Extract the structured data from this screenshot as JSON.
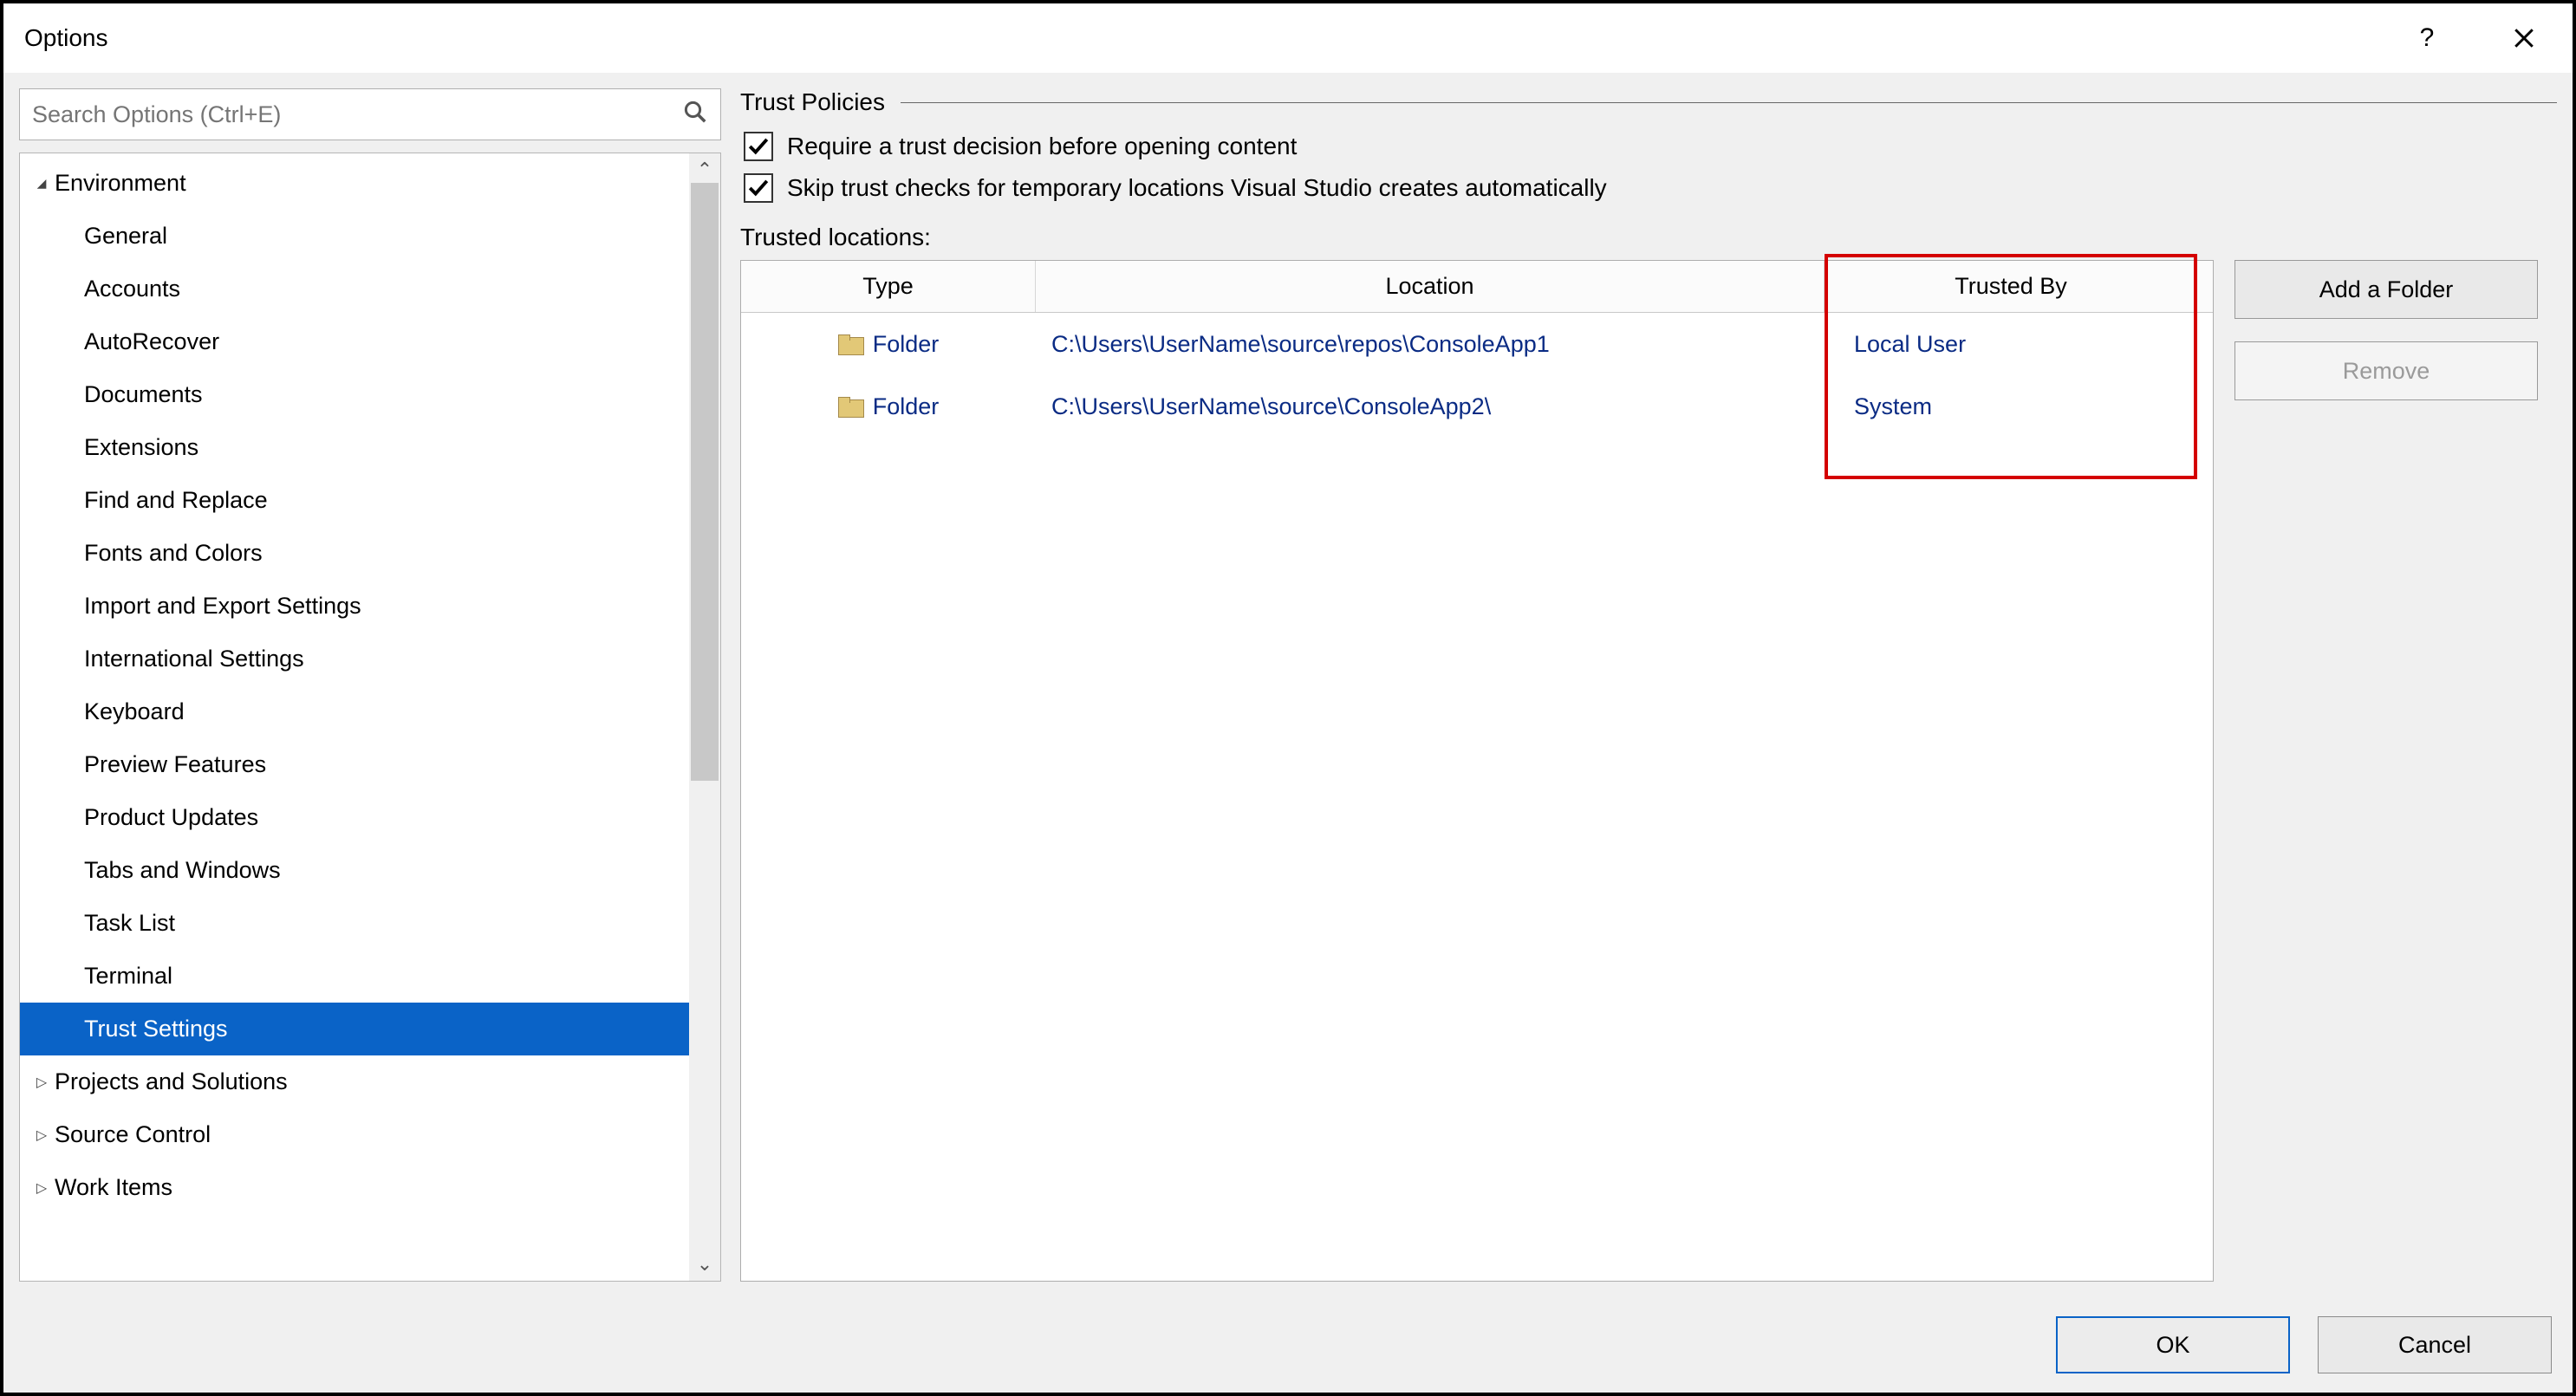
{
  "title": "Options",
  "search": {
    "placeholder": "Search Options (Ctrl+E)"
  },
  "tree": {
    "items": [
      {
        "label": "Environment",
        "level": 0,
        "expander": "▾",
        "selected": false
      },
      {
        "label": "General",
        "level": 1,
        "expander": "",
        "selected": false
      },
      {
        "label": "Accounts",
        "level": 1,
        "expander": "",
        "selected": false
      },
      {
        "label": "AutoRecover",
        "level": 1,
        "expander": "",
        "selected": false
      },
      {
        "label": "Documents",
        "level": 1,
        "expander": "",
        "selected": false
      },
      {
        "label": "Extensions",
        "level": 1,
        "expander": "",
        "selected": false
      },
      {
        "label": "Find and Replace",
        "level": 1,
        "expander": "",
        "selected": false
      },
      {
        "label": "Fonts and Colors",
        "level": 1,
        "expander": "",
        "selected": false
      },
      {
        "label": "Import and Export Settings",
        "level": 1,
        "expander": "",
        "selected": false
      },
      {
        "label": "International Settings",
        "level": 1,
        "expander": "",
        "selected": false
      },
      {
        "label": "Keyboard",
        "level": 1,
        "expander": "",
        "selected": false
      },
      {
        "label": "Preview Features",
        "level": 1,
        "expander": "",
        "selected": false
      },
      {
        "label": "Product Updates",
        "level": 1,
        "expander": "",
        "selected": false
      },
      {
        "label": "Tabs and Windows",
        "level": 1,
        "expander": "",
        "selected": false
      },
      {
        "label": "Task List",
        "level": 1,
        "expander": "",
        "selected": false
      },
      {
        "label": "Terminal",
        "level": 1,
        "expander": "",
        "selected": false
      },
      {
        "label": "Trust Settings",
        "level": 1,
        "expander": "",
        "selected": true
      },
      {
        "label": "Projects and Solutions",
        "level": 0,
        "expander": "▹",
        "selected": false
      },
      {
        "label": "Source Control",
        "level": 0,
        "expander": "▹",
        "selected": false
      },
      {
        "label": "Work Items",
        "level": 0,
        "expander": "▹",
        "selected": false
      }
    ]
  },
  "right": {
    "group_title": "Trust Policies",
    "check1": "Require a trust decision before opening content",
    "check2": "Skip trust checks for temporary locations Visual Studio creates automatically",
    "locations_label": "Trusted locations:",
    "columns": {
      "type": "Type",
      "location": "Location",
      "trusted_by": "Trusted By"
    },
    "rows": [
      {
        "type": "Folder",
        "location": "C:\\Users\\UserName\\source\\repos\\ConsoleApp1",
        "trusted_by": "Local User"
      },
      {
        "type": "Folder",
        "location": "C:\\Users\\UserName\\source\\ConsoleApp2\\",
        "trusted_by": "System"
      }
    ],
    "add_folder": "Add a Folder",
    "remove": "Remove"
  },
  "footer": {
    "ok": "OK",
    "cancel": "Cancel"
  }
}
